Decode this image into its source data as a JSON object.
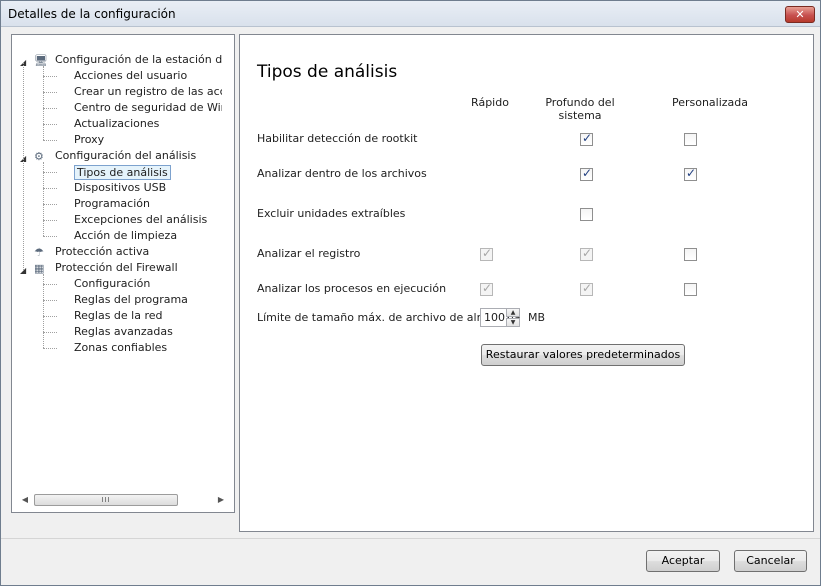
{
  "window": {
    "title": "Detalles de la configuración",
    "close_label": "✕"
  },
  "tree": {
    "groups": [
      {
        "label": "Configuración de la estación de trat",
        "icon": "workstation-icon",
        "children": [
          "Acciones del usuario",
          "Crear un registro de las accione",
          "Centro de seguridad de Window",
          "Actualizaciones",
          "Proxy"
        ]
      },
      {
        "label": "Configuración del análisis",
        "icon": "scan-config-icon",
        "children": [
          "Tipos de análisis",
          "Dispositivos USB",
          "Programación",
          "Excepciones del análisis",
          "Acción de limpieza"
        ]
      },
      {
        "label": "Protección activa",
        "icon": "active-protection-icon",
        "children": []
      },
      {
        "label": "Protección del Firewall",
        "icon": "firewall-icon",
        "children": [
          "Configuración",
          "Reglas del  programa",
          "Reglas de la red",
          "Reglas avanzadas",
          "Zonas confiables"
        ]
      }
    ],
    "selected": "Tipos de análisis",
    "scrollbar_thumb_label": "III"
  },
  "content": {
    "title": "Tipos de análisis",
    "columns": [
      "Rápido",
      "Profundo del sistema",
      "Personalizada"
    ],
    "rows": [
      {
        "label": "Habilitar detección de rootkit",
        "checks": [
          null,
          {
            "checked": true,
            "enabled": true
          },
          {
            "checked": false,
            "enabled": true
          }
        ]
      },
      {
        "label": "Analizar dentro de los archivos",
        "checks": [
          null,
          {
            "checked": true,
            "enabled": true
          },
          {
            "checked": true,
            "enabled": true
          }
        ]
      },
      {
        "label": "Excluir unidades extraíbles",
        "checks": [
          null,
          {
            "checked": false,
            "enabled": true
          },
          null
        ]
      },
      {
        "label": "Analizar el registro",
        "checks": [
          {
            "checked": true,
            "enabled": false
          },
          {
            "checked": true,
            "enabled": false
          },
          {
            "checked": false,
            "enabled": true
          }
        ]
      },
      {
        "label": "Analizar los procesos en ejecución",
        "checks": [
          {
            "checked": true,
            "enabled": false
          },
          {
            "checked": true,
            "enabled": false
          },
          {
            "checked": false,
            "enabled": true
          }
        ]
      }
    ],
    "size_limit": {
      "label": "Límite de tamaño máx. de archivo de almacena",
      "value": "100",
      "unit": "MB"
    },
    "restore_button": "Restaurar valores predeterminados"
  },
  "footer": {
    "ok_label": "Aceptar",
    "cancel_label": "Cancelar"
  }
}
